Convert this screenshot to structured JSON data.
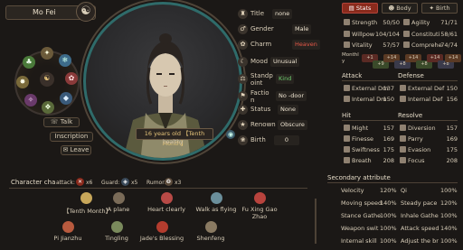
{
  "character": {
    "name": "Mo Fei",
    "age_label": "16 years old 【Tenth Month】",
    "health": "healthy"
  },
  "left_buttons": {
    "talk": "Talk",
    "inscription": "Inscription",
    "leave": "Leave"
  },
  "attributes": [
    {
      "label": "Title",
      "value": "none",
      "color": "default"
    },
    {
      "label": "Gender",
      "value": "Male",
      "color": "default"
    },
    {
      "label": "Charm",
      "value": "Heaven",
      "color": "red"
    },
    {
      "label": "Mood",
      "value": "Unusual",
      "color": "default"
    },
    {
      "label": "Standp oint",
      "value": "Kind",
      "color": "green"
    },
    {
      "label": "Factio n",
      "value": "No -door",
      "color": "default"
    },
    {
      "label": "Status",
      "value": "None",
      "color": "default"
    },
    {
      "label": "Renown",
      "value": "Obscure",
      "color": "default"
    },
    {
      "label": "Birth",
      "value": "0",
      "color": "default"
    }
  ],
  "tabs": [
    {
      "label": "Stats",
      "active": true
    },
    {
      "label": "Body",
      "active": false
    },
    {
      "label": "Birth",
      "active": false
    }
  ],
  "core_stats": [
    {
      "label": "Strength",
      "value": "50/50",
      "red": false
    },
    {
      "label": "Agility",
      "value": "71/71",
      "red": false
    },
    {
      "label": "Willpow",
      "value": "104/104",
      "red": false
    },
    {
      "label": "Constituti",
      "value": "58/61",
      "red": false
    },
    {
      "label": "Vitality",
      "value": "57/57",
      "red": false
    },
    {
      "label": "Comprehe",
      "value": "74/74",
      "red": false
    }
  ],
  "monthly": {
    "label": "Monthl y",
    "items": [
      "+1",
      "+9",
      "+14",
      "+8",
      "+14",
      "+8",
      "+14",
      "+8",
      "+14"
    ]
  },
  "attack": {
    "header": "Attack",
    "rows": [
      {
        "label": "External Dm",
        "value": "137"
      },
      {
        "label": "Internal Dm",
        "value": "150"
      }
    ]
  },
  "defense": {
    "header": "Defense",
    "rows": [
      {
        "label": "External Def",
        "value": "150"
      },
      {
        "label": "Internal Def",
        "value": "156"
      }
    ]
  },
  "hit": {
    "header": "Hit",
    "rows": [
      {
        "label": "Might",
        "value": "157"
      },
      {
        "label": "Finesse",
        "value": "169"
      },
      {
        "label": "Swiftness",
        "value": "175"
      },
      {
        "label": "Breath",
        "value": "208"
      }
    ]
  },
  "resolve": {
    "header": "Resolve",
    "rows": [
      {
        "label": "Diversion",
        "value": "157"
      },
      {
        "label": "Parry",
        "value": "169"
      },
      {
        "label": "Evasion",
        "value": "175"
      },
      {
        "label": "Focus",
        "value": "208"
      }
    ]
  },
  "secondary": {
    "header": "Secondary attribute",
    "rows": [
      {
        "l1": "Velocity",
        "v1": "120%",
        "l2": "Qi",
        "v2": "100%"
      },
      {
        "l1": "Moving speed",
        "v1": "140%",
        "l2": "Steady pace",
        "v2": "120%"
      },
      {
        "l1": "Stance Gathe",
        "v1": "100%",
        "l2": "Inhale Gathe",
        "v2": "100%"
      },
      {
        "l1": "Weapon swit",
        "v1": "100%",
        "l2": "Attack speed",
        "v2": "140%"
      },
      {
        "l1": "Internal skill",
        "v1": "100%",
        "l2": "Adjust the br",
        "v2": "100%"
      }
    ]
  },
  "traits_bar": {
    "label": "Character cha",
    "attack_label": "attack:",
    "attack_count": "x6",
    "guard_label": "Guard:",
    "guard_count": "x5",
    "rumor_label": "Rumor:",
    "rumor_count": "x3"
  },
  "traits": [
    {
      "label": "【Tenth Month】",
      "color": "#c8a75a"
    },
    {
      "label": "A plane",
      "color": "#7a6b58"
    },
    {
      "label": "Heart clearly",
      "color": "#b84a46"
    },
    {
      "label": "Walk as flying",
      "color": "#6b8f9b"
    },
    {
      "label": "Fu Xing Gao Zhao",
      "color": "#b8433d"
    },
    {
      "label": "Pi Jianzhu",
      "color": "#b85a3e"
    },
    {
      "label": "Tingling",
      "color": "#7a8a5c"
    },
    {
      "label": "Jade's Blessing",
      "color": "#b43c2e"
    },
    {
      "label": "Shenfeng",
      "color": "#8a7a62"
    }
  ],
  "colors": {
    "accent_red": "#8a2a1c",
    "teal_ring": "#2f6b6a",
    "gold": "#e5c47a"
  }
}
